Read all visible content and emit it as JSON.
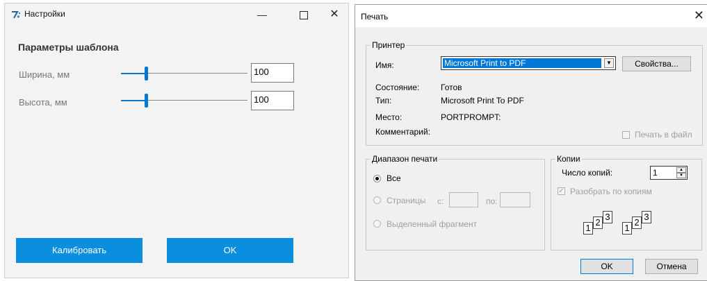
{
  "settings": {
    "title": "Настройки",
    "controls": {
      "minimize": "—",
      "close": "✕"
    },
    "section_title": "Параметры шаблона",
    "width": {
      "label": "Ширина, мм",
      "value": "100"
    },
    "height": {
      "label": "Высота,   мм",
      "value": "100"
    },
    "buttons": {
      "calibrate": "Калибровать",
      "ok": "OK"
    },
    "accent": "#0a8ee0"
  },
  "print": {
    "title": "Печать",
    "close": "✕",
    "printer_group": "Принтер",
    "name_label": "Имя:",
    "name_value": "Microsoft Print to PDF",
    "properties": "Свойства...",
    "status_label": "Состояние:",
    "status_value": "Готов",
    "type_label": "Тип:",
    "type_value": "Microsoft Print To PDF",
    "where_label": "Место:",
    "where_value": "PORTPROMPT:",
    "comment_label": "Комментарий:",
    "print_to_file": "Печать в файл",
    "range_group": "Диапазон печати",
    "all": "Все",
    "pages": "Страницы",
    "from": "с:",
    "to": "по:",
    "selection": "Выделенный фрагмент",
    "copies_group": "Копии",
    "copies_label": "Число копий:",
    "copies_value": "1",
    "collate": "Разобрать по копиям",
    "ok": "OK",
    "cancel": "Отмена"
  }
}
